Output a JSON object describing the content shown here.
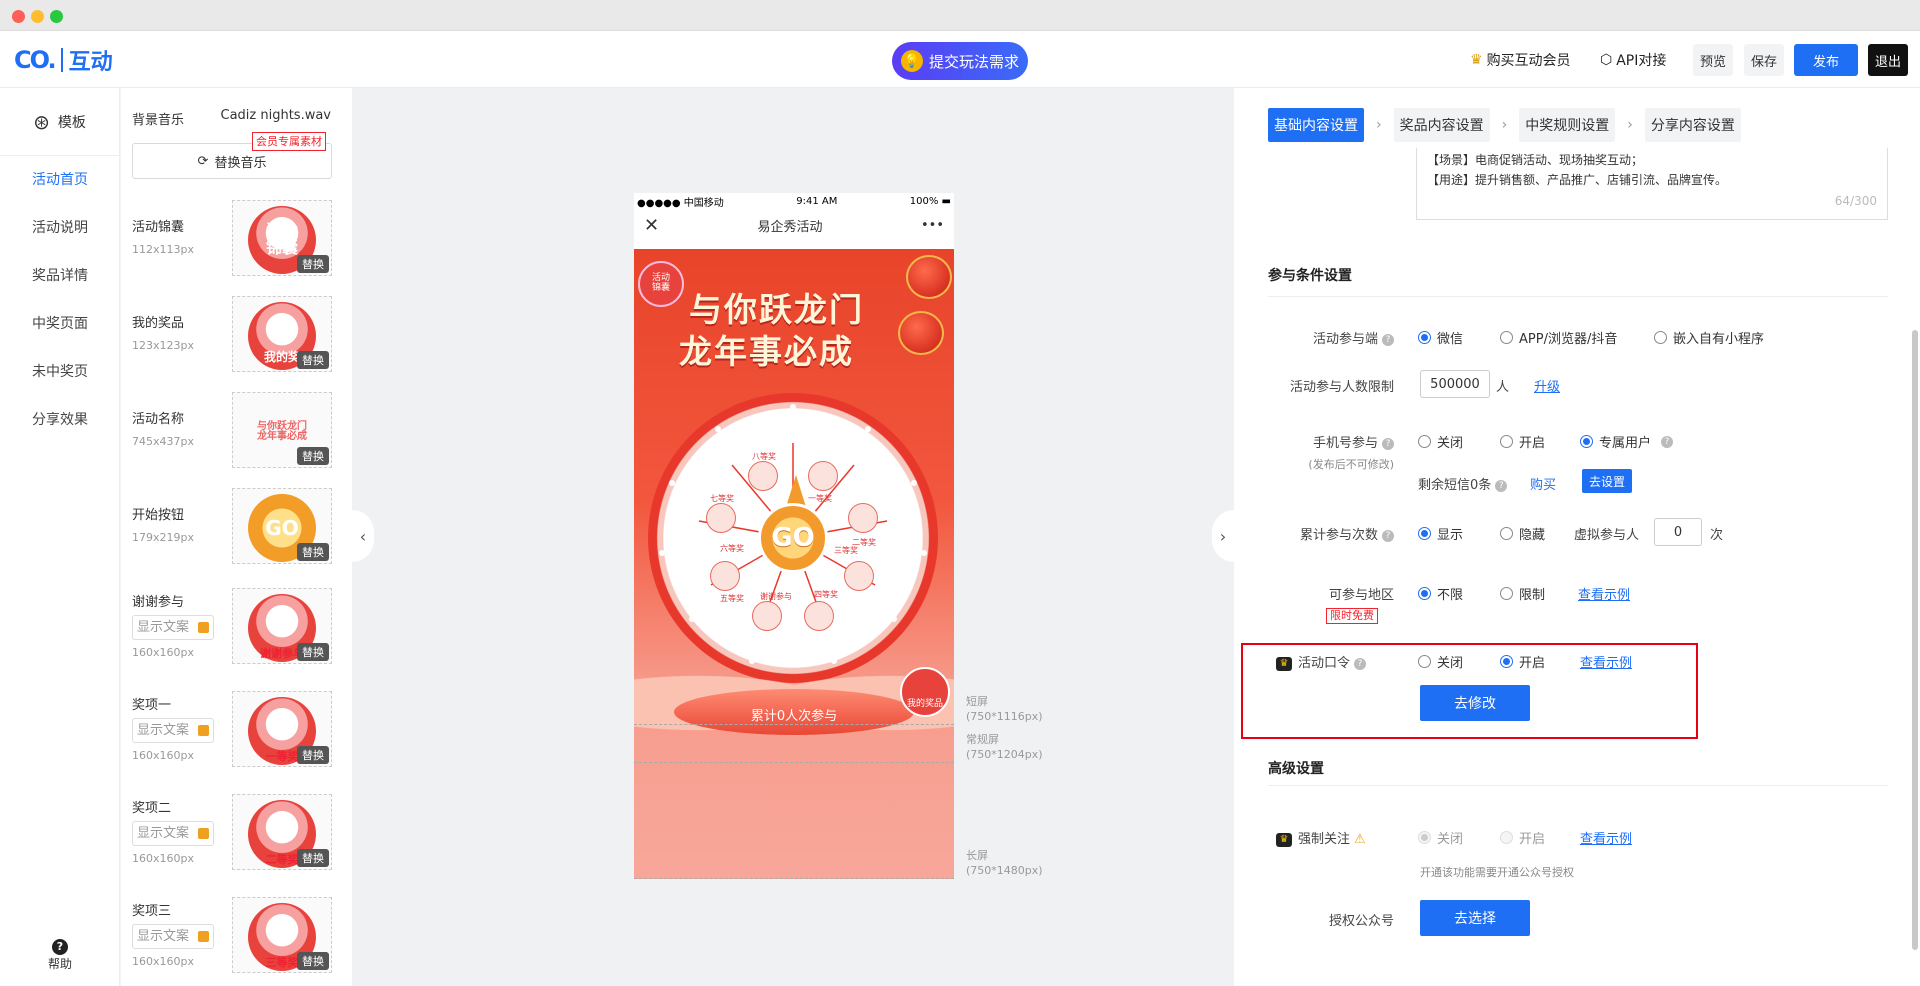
{
  "app": {
    "logo_text": "互动",
    "logo_mark": "CO."
  },
  "header": {
    "submit_label": "提交玩法需求",
    "buy_vip": "购买互动会员",
    "api": "API对接",
    "preview": "预览",
    "save": "保存",
    "publish": "发布",
    "exit": "退出"
  },
  "leftnav": {
    "template": "模板",
    "items": [
      "活动首页",
      "活动说明",
      "奖品详情",
      "中奖页面",
      "未中奖页",
      "分享效果"
    ],
    "active_index": 0,
    "help": "帮助"
  },
  "assets": {
    "music_label": "背景音乐",
    "music_file": "Cadiz nights.wav",
    "vip_tag": "会员专属素材",
    "replace_music": "替换音乐",
    "swap_label": "替换",
    "show_text_placeholder": "显示文案",
    "items": [
      {
        "name": "活动锦囊",
        "size": "112x113px",
        "thumb": "活动\n锦囊"
      },
      {
        "name": "我的奖品",
        "size": "123x123px",
        "thumb": "我的奖"
      },
      {
        "name": "活动名称",
        "size": "745x437px",
        "thumb": "与你跃龙门\n龙年事必成"
      },
      {
        "name": "开始按钮",
        "size": "179x219px",
        "thumb": "GO"
      },
      {
        "name": "谢谢参与",
        "size": "160x160px",
        "thumb": "谢谢参与"
      },
      {
        "name": "奖项一",
        "size": "160x160px",
        "thumb": "一等奖"
      },
      {
        "name": "奖项二",
        "size": "160x160px",
        "thumb": "二等奖"
      },
      {
        "name": "奖项三",
        "size": "160x160px",
        "thumb": "三等奖"
      }
    ]
  },
  "phone": {
    "carrier": "●●●●● 中国移动",
    "time": "9:41 AM",
    "battery": "100%",
    "title": "易企秀活动",
    "close": "✕",
    "more": "•••",
    "headline1": "与你跃龙门",
    "headline2": "龙年事必成",
    "act_bag": "活动\n锦囊",
    "go": "GO",
    "count_text": "累计0人次参与",
    "my_prize": "我的奖品",
    "prizes": [
      "一等奖",
      "二等奖",
      "三等奖",
      "四等奖",
      "五等奖",
      "谢谢参与",
      "六等奖",
      "七等奖",
      "八等奖"
    ]
  },
  "guides": [
    {
      "label": "短屏",
      "size": "(750*1116px)"
    },
    {
      "label": "常规屏",
      "size": "(750*1204px)"
    },
    {
      "label": "长屏",
      "size": "(750*1480px)"
    }
  ],
  "settings": {
    "steps": [
      "基础内容设置",
      "奖品内容设置",
      "中奖规则设置",
      "分享内容设置"
    ],
    "active_step": 0,
    "desc_line1": "【场景】电商促销活动、现场抽奖互动；",
    "desc_line2": "【用途】提升销售额、产品推广、店铺引流、品牌宣传。",
    "desc_counter": "64/300",
    "cond_title": "参与条件设置",
    "platform_label": "活动参与端",
    "platform_opts": [
      "微信",
      "APP/浏览器/抖音",
      "嵌入自有小程序"
    ],
    "limit_label": "活动参与人数限制",
    "limit_value": "500000",
    "limit_unit": "人",
    "upgrade": "升级",
    "phone_label": "手机号参与",
    "phone_sub": "(发布后不可修改)",
    "phone_opts": [
      "关闭",
      "开启",
      "专属用户"
    ],
    "sms_text": "剩余短信0条",
    "sms_count": "0",
    "buy": "购买",
    "goset": "去设置",
    "cum_label": "累计参与次数",
    "cum_opts": [
      "显示",
      "隐藏"
    ],
    "virtual_label": "虚拟参与人",
    "virtual_value": "0",
    "virtual_unit": "次",
    "region_label": "可参与地区",
    "region_tag": "限时免费",
    "region_opts": [
      "不限",
      "限制"
    ],
    "see_example": "查看示例",
    "password_label": "活动口令",
    "password_opts": [
      "关闭",
      "开启"
    ],
    "modify": "去修改",
    "adv_title": "高级设置",
    "follow_label": "强制关注",
    "follow_opts": [
      "关闭",
      "开启"
    ],
    "follow_hint": "开通该功能需要开通公众号授权",
    "auth_label": "授权公众号",
    "choose": "去选择"
  }
}
